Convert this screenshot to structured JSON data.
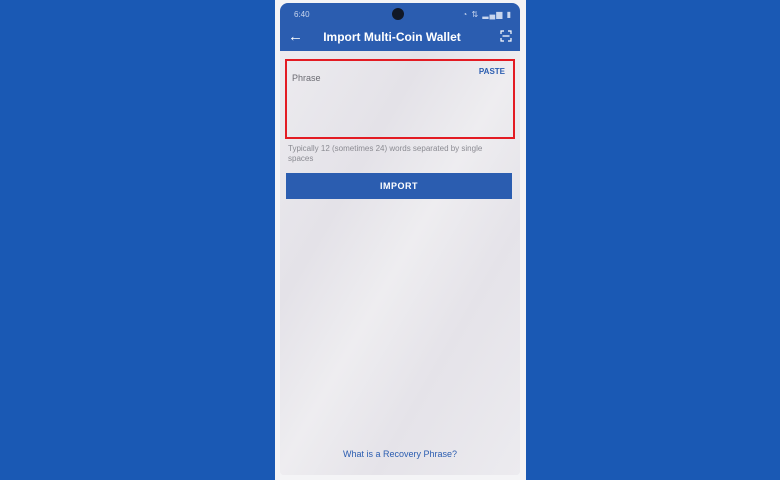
{
  "status_bar": {
    "time": "6:40",
    "icons": "◔ ⇅ ▂▄▆ ▮"
  },
  "app_bar": {
    "title": "Import Multi-Coin Wallet",
    "back_icon": "←",
    "scan_icon": "qr-scan-icon"
  },
  "phrase_field": {
    "placeholder": "Phrase",
    "paste_label": "PASTE",
    "value": ""
  },
  "hint": "Typically 12 (sometimes 24) words separated by single spaces",
  "import_button": {
    "label": "IMPORT"
  },
  "recovery_link": "What is a Recovery Phrase?",
  "colors": {
    "background": "#1a59b4",
    "app_bar": "#2b5db0",
    "highlight_border": "#e31b23",
    "accent_text": "#2b5db0"
  }
}
